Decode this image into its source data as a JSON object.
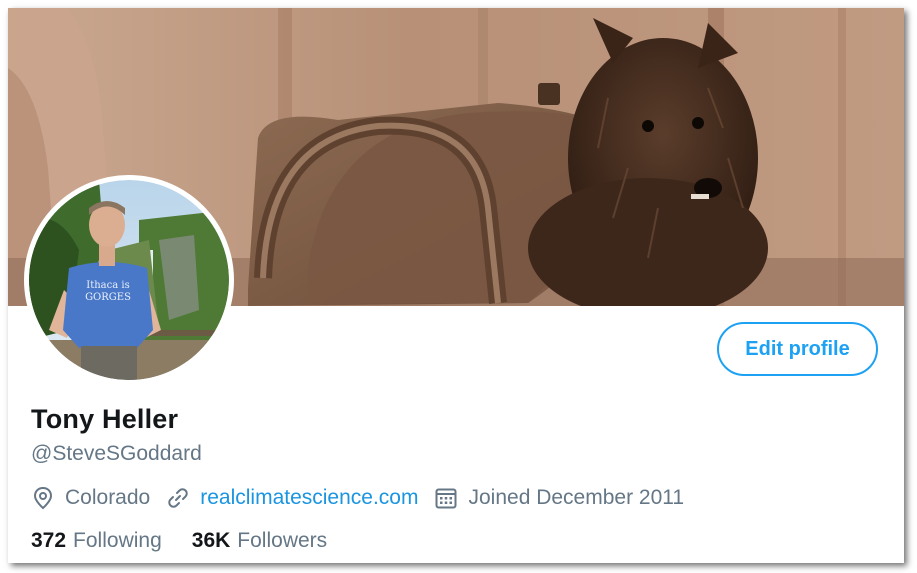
{
  "profile": {
    "display_name": "Tony Heller",
    "handle": "@SteveSGoddard",
    "avatar_shirt_text_line1": "Ithaca is",
    "avatar_shirt_text_line2": "GORGES"
  },
  "actions": {
    "edit_profile_label": "Edit profile"
  },
  "meta": {
    "location": "Colorado",
    "location_icon": "location-pin-icon",
    "website": "realclimatescience.com",
    "website_icon": "link-icon",
    "joined": "Joined December 2011",
    "joined_icon": "calendar-icon"
  },
  "stats": {
    "following_count": "372",
    "following_label": "Following",
    "followers_count": "36K",
    "followers_label": "Followers"
  },
  "colors": {
    "accent": "#1da1f2",
    "link": "#1b95e0",
    "text_primary": "#14171a",
    "text_secondary": "#657786"
  }
}
